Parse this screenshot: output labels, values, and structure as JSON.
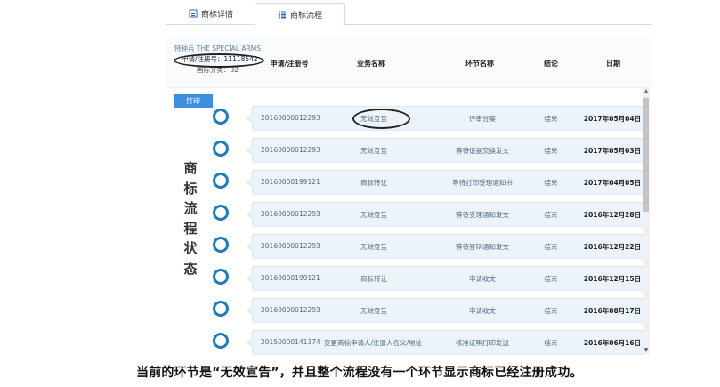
{
  "tabs": {
    "detail": "商标详情",
    "flow": "商标流程"
  },
  "info": {
    "name": "特种兵 THE SPECIAL ARMS",
    "reg": "申请/注册号：11118542",
    "class": "国际分类：32"
  },
  "columns": {
    "id": "申请/注册号",
    "business": "业务名称",
    "step": "环节名称",
    "result": "结论",
    "date": "日期"
  },
  "print_label": "打印",
  "side_title": [
    "商",
    "标",
    "流",
    "程",
    "状",
    "态"
  ],
  "rows": [
    {
      "id": "20160000012293",
      "business": "无效宣告",
      "step": "评审分案",
      "result": "结束",
      "date": "2017年05月04日"
    },
    {
      "id": "20160000012293",
      "business": "无效宣告",
      "step": "等待证据交换发文",
      "result": "结束",
      "date": "2017年05月03日"
    },
    {
      "id": "20160000199121",
      "business": "商标转让",
      "step": "等待打印受理通知书",
      "result": "结束",
      "date": "2017年04月05日"
    },
    {
      "id": "20160000012293",
      "business": "无效宣告",
      "step": "等待受理通知发文",
      "result": "结束",
      "date": "2016年12月28日"
    },
    {
      "id": "20160000012293",
      "business": "无效宣告",
      "step": "等待答辩通知发文",
      "result": "结束",
      "date": "2016年12月22日"
    },
    {
      "id": "20160000199121",
      "business": "商标转让",
      "step": "申请收文",
      "result": "结束",
      "date": "2016年12月15日"
    },
    {
      "id": "20160000012293",
      "business": "无效宣告",
      "step": "申请收文",
      "result": "结束",
      "date": "2016年08月17日"
    },
    {
      "id": "20150000141374",
      "business": "变更商标申请人/注册人名义/地址",
      "step": "核准证明打印发送",
      "result": "结束",
      "date": "2016年06月16日"
    }
  ],
  "caption": "当前的环节是“无效宣告”，并且整个流程没有一个环节显示商标已经注册成功。",
  "colors": {
    "accent": "#3f8fe0",
    "timeline": "#1b7fbd",
    "row_bg": "#ecf4fa"
  }
}
